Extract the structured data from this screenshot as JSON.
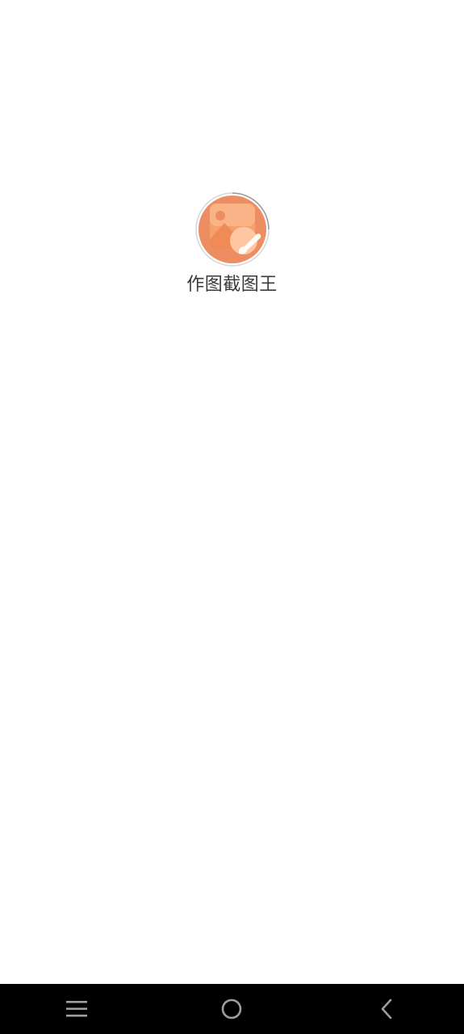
{
  "splash": {
    "app_name": "作图截图王",
    "logo_icon": "picture-brush-icon",
    "logo_colors": {
      "circle": "#ec8d62",
      "tile": "#f7a06e",
      "accent": "#ffd0b0"
    }
  },
  "navigation_bar": {
    "background": "#000000",
    "buttons": [
      {
        "name": "menu",
        "icon": "menu-icon"
      },
      {
        "name": "home",
        "icon": "home-circle-icon"
      },
      {
        "name": "back",
        "icon": "back-chevron-icon"
      }
    ]
  }
}
